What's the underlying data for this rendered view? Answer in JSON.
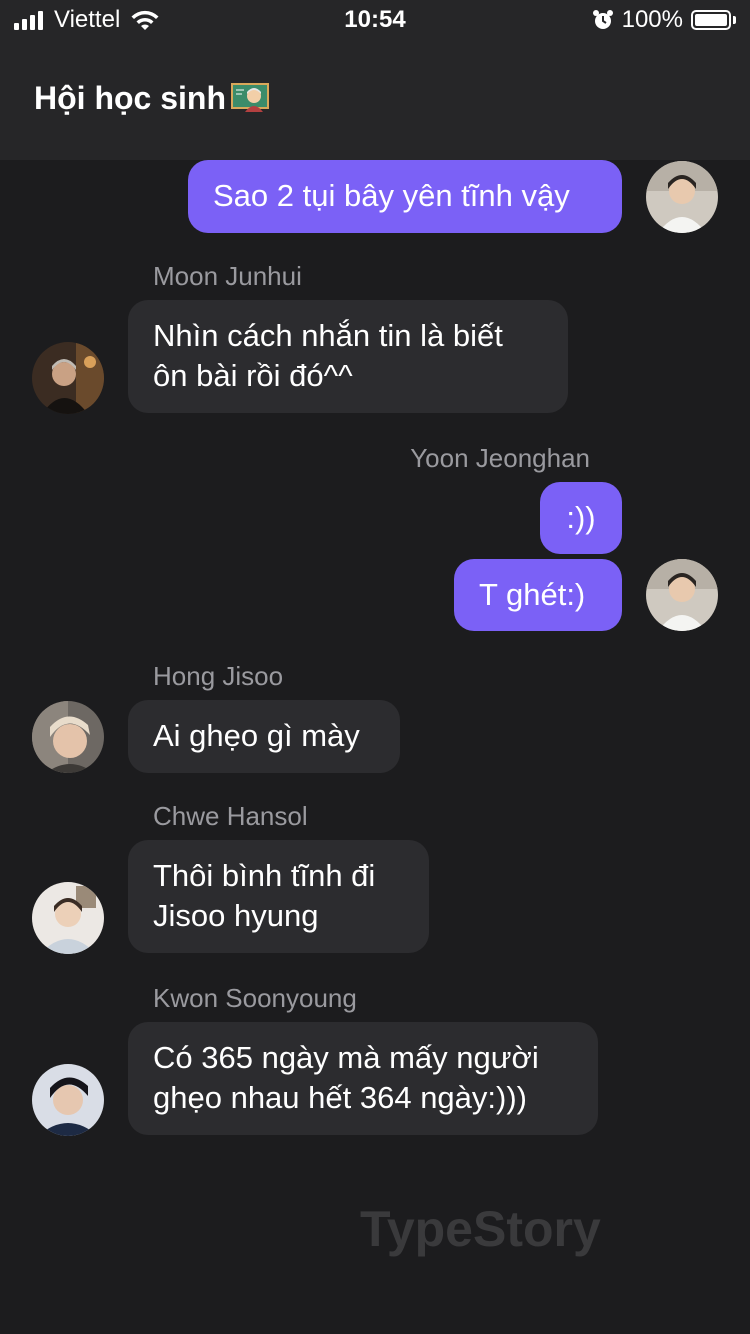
{
  "status_bar": {
    "carrier": "Viettel",
    "time": "10:54",
    "battery_percent": "100%",
    "icons": [
      "signal-icon",
      "wifi-icon",
      "alarm-icon",
      "battery-icon"
    ]
  },
  "header": {
    "title": "Hội học sinh",
    "title_icon": "teacher-emoji-icon"
  },
  "messages": [
    {
      "sender": "",
      "text": "Sao 2 tụi bây yên tĩnh vậy",
      "side": "right",
      "avatar": "avatar-boy-white-shirt"
    },
    {
      "sender": "Moon Junhui",
      "text_lines": [
        "Nhìn cách nhắn tin là biết",
        "ôn bài rồi đó^^"
      ],
      "side": "left",
      "avatar": "avatar-moon-junhui"
    },
    {
      "sender": "Yoon Jeonghan",
      "text": ":))",
      "side": "right"
    },
    {
      "sender": "",
      "text": "T ghét:)",
      "side": "right",
      "avatar": "avatar-boy-white-shirt"
    },
    {
      "sender": "Hong Jisoo",
      "text": "Ai ghẹo gì mày",
      "side": "left",
      "avatar": "avatar-hong-jisoo"
    },
    {
      "sender": "Chwe Hansol",
      "text_lines": [
        "Thôi bình tĩnh đi",
        "Jisoo hyung"
      ],
      "side": "left",
      "avatar": "avatar-chwe-hansol"
    },
    {
      "sender": "Kwon Soonyoung",
      "text_lines": [
        "Có 365 ngày mà mấy người",
        "ghẹo nhau hết 364 ngày:)))"
      ],
      "side": "left",
      "avatar": "avatar-kwon-soonyoung"
    }
  ],
  "watermark": "TypeStory",
  "colors": {
    "background": "#1c1c1e",
    "header_bg": "#262628",
    "my_bubble": "#7b61f6",
    "their_bubble": "#2c2c2f",
    "sender_name": "#9a9a9f"
  }
}
